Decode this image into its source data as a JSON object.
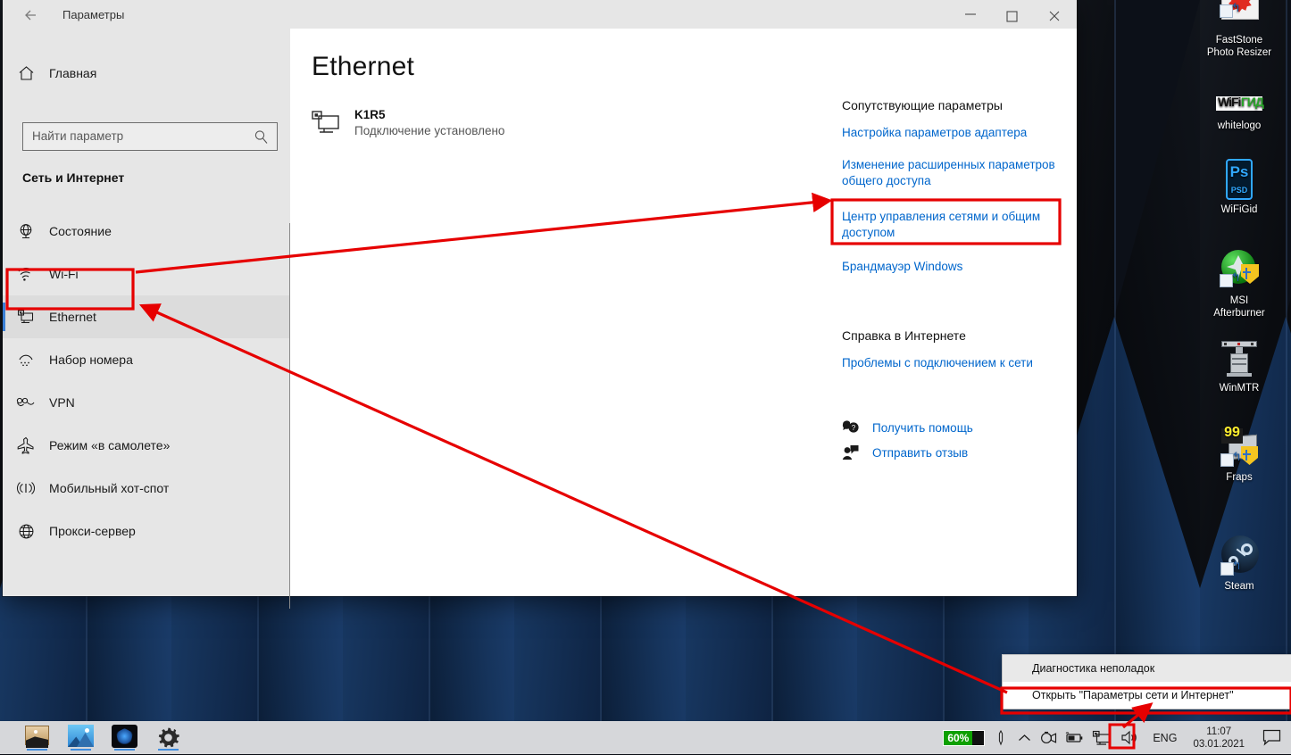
{
  "window": {
    "title": "Параметры",
    "back_icon": "back-arrow-icon",
    "minimize_icon": "minimize-icon",
    "maximize_icon": "maximize-icon",
    "close_icon": "close-icon"
  },
  "sidebar": {
    "home": {
      "label": "Главная",
      "icon": "home-icon"
    },
    "search": {
      "placeholder": "Найти параметр",
      "icon": "search-icon"
    },
    "group_title": "Сеть и Интернет",
    "items": [
      {
        "label": "Состояние",
        "icon": "globe-status-icon",
        "selected": false
      },
      {
        "label": "Wi-Fi",
        "icon": "wifi-icon",
        "selected": false
      },
      {
        "label": "Ethernet",
        "icon": "ethernet-icon",
        "selected": true
      },
      {
        "label": "Набор номера",
        "icon": "dialup-icon",
        "selected": false
      },
      {
        "label": "VPN",
        "icon": "vpn-icon",
        "selected": false
      },
      {
        "label": "Режим «в самолете»",
        "icon": "airplane-icon",
        "selected": false
      },
      {
        "label": "Мобильный хот-спот",
        "icon": "hotspot-icon",
        "selected": false
      },
      {
        "label": "Прокси-сервер",
        "icon": "proxy-globe-icon",
        "selected": false
      }
    ]
  },
  "content": {
    "heading": "Ethernet",
    "adapter": {
      "icon": "ethernet-adapter-icon",
      "name": "K1R5",
      "status": "Подключение установлено"
    },
    "related": {
      "heading": "Сопутствующие параметры",
      "links": [
        "Настройка параметров адаптера",
        "Изменение расширенных параметров общего доступа",
        "Центр управления сетями и общим доступом",
        "Брандмауэр Windows"
      ]
    },
    "help": {
      "heading": "Справка в Интернете",
      "link": "Проблемы с подключением к сети",
      "actions": [
        {
          "label": "Получить помощь",
          "icon": "question-bubble-icon"
        },
        {
          "label": "Отправить отзыв",
          "icon": "feedback-person-icon"
        }
      ]
    }
  },
  "desktop": {
    "icons": [
      {
        "label": "FastStone\nPhoto Resizer",
        "icon": "faststone-photo-resizer-icon"
      },
      {
        "label": "whitelogo",
        "icon": "wifigid-logo-icon"
      },
      {
        "label": "WiFiGid",
        "icon": "photoshop-psd-icon"
      },
      {
        "label": "MSI\nAfterburner",
        "icon": "msi-afterburner-icon"
      },
      {
        "label": "WinMTR",
        "icon": "winmtr-icon"
      },
      {
        "label": "Fraps",
        "icon": "fraps-icon"
      },
      {
        "label": "Steam",
        "icon": "steam-icon"
      }
    ]
  },
  "taskbar": {
    "apps": [
      {
        "icon": "file-explorer-app-icon"
      },
      {
        "icon": "photos-app-icon"
      },
      {
        "icon": "blue-network-app-icon"
      },
      {
        "icon": "settings-gear-app-icon"
      }
    ],
    "tray": {
      "battery_percent": "60%",
      "icons": [
        "pen-icon",
        "show-hidden-icons-chevron",
        "camera-icon",
        "battery-icon",
        "ethernet-network-icon",
        "volume-icon"
      ],
      "language": "ENG",
      "time": "11:07",
      "date": "03.01.2021",
      "action_center_icon": "action-center-icon"
    }
  },
  "context_menu": {
    "items": [
      "Диагностика неполадок",
      "Открыть \"Параметры сети и Интернет\""
    ]
  },
  "annotations": {
    "color": "#e60000",
    "boxes": [
      "sidebar-ethernet-item",
      "network-and-sharing-center-link",
      "open-network-internet-settings-menu-item",
      "tray-ethernet-icon"
    ],
    "arrows": [
      "ethernet-item-to-sharing-center-link",
      "context-menu-item-to-ethernet-item",
      "tray-icon-to-context-menu-item"
    ]
  }
}
